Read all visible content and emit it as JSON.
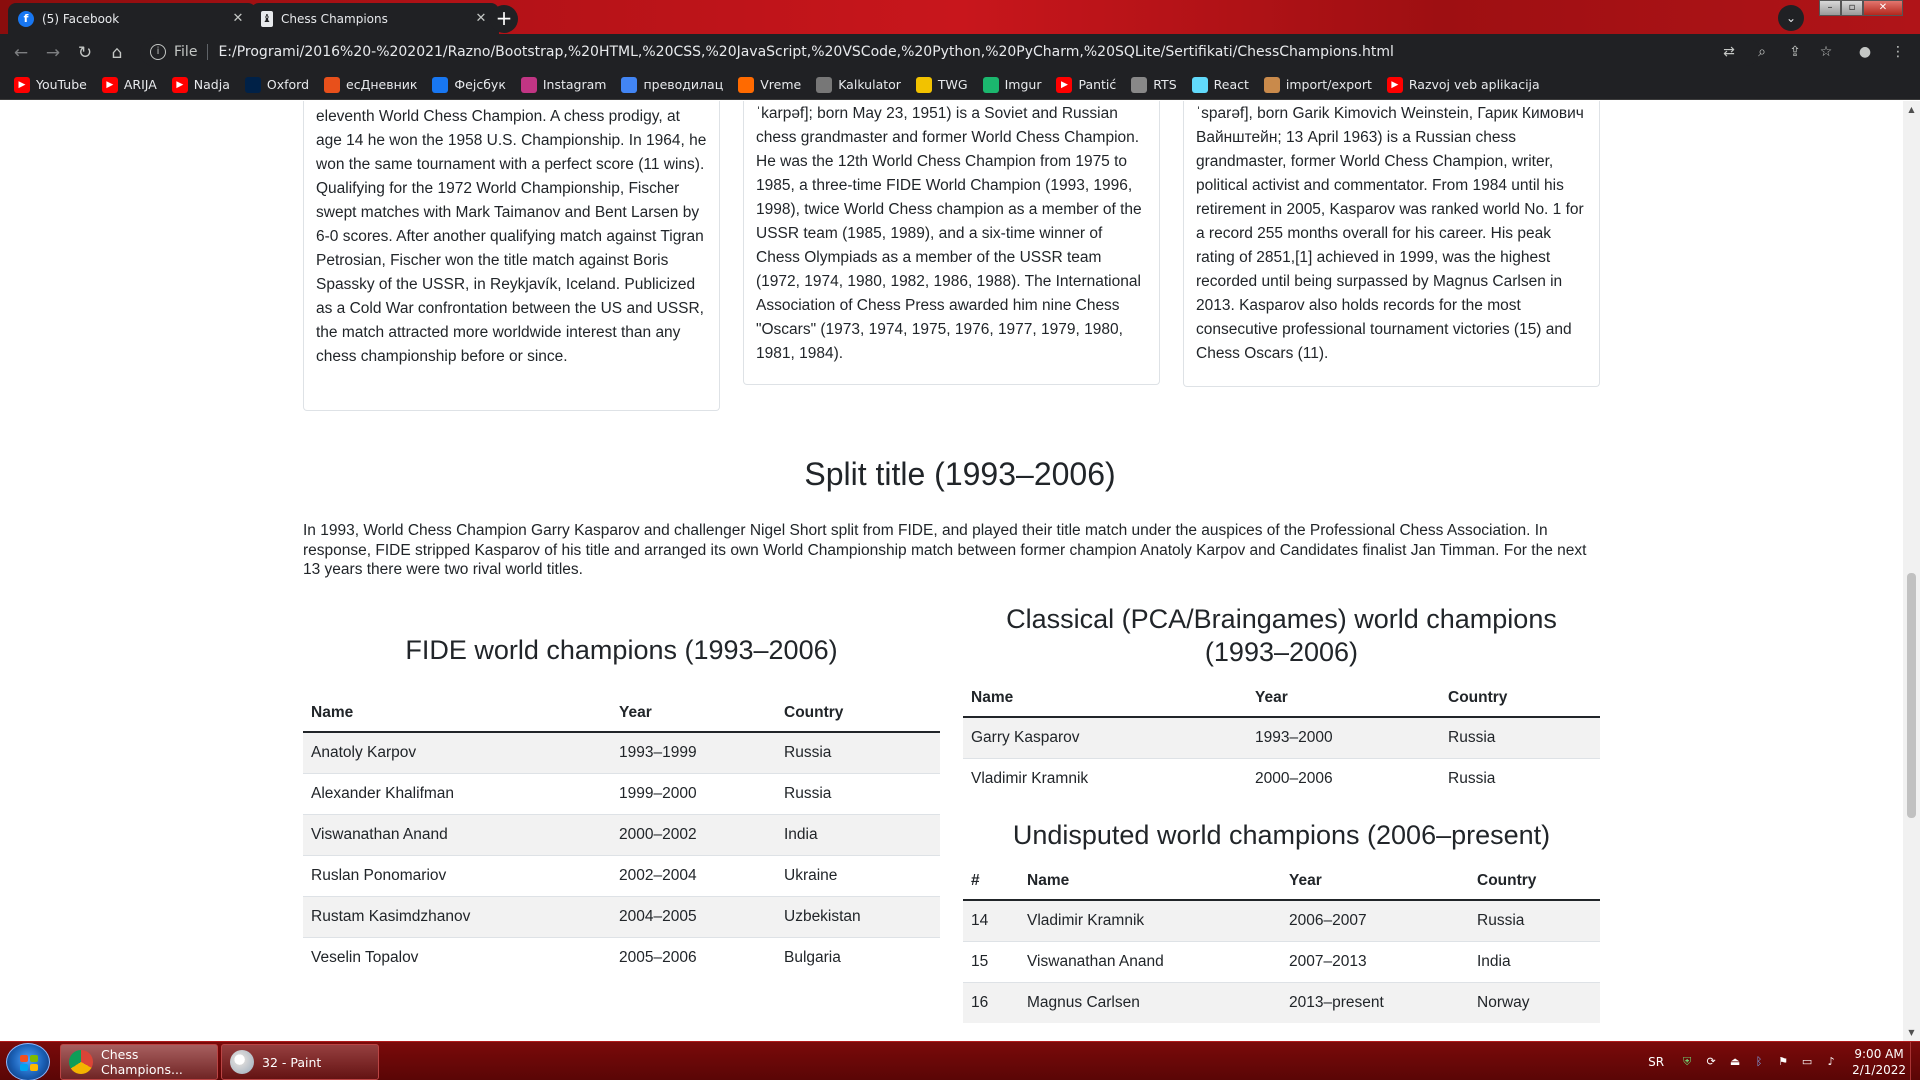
{
  "browser": {
    "tabs": [
      {
        "title": "(5) Facebook",
        "icon": "facebook-icon"
      },
      {
        "title": "Chess Champions",
        "icon": "chess-piece-icon"
      }
    ],
    "address": {
      "scheme": "File",
      "url": "E:/Programi/2016%20-%202021/Razno/Bootstrap,%20HTML,%20CSS,%20JavaScript,%20VSCode,%20Python,%20PyCharm,%20SQLite/Sertifikati/ChessChampions.html"
    },
    "bookmarks": [
      {
        "label": "YouTube",
        "icon": "youtube-icon",
        "color": "#ff0000"
      },
      {
        "label": "ARIJA",
        "icon": "youtube-icon",
        "color": "#ff0000"
      },
      {
        "label": "Nadja",
        "icon": "youtube-icon",
        "color": "#ff0000"
      },
      {
        "label": "Oxford",
        "icon": "oup-icon",
        "color": "#002147"
      },
      {
        "label": "есДневник",
        "icon": "esdnevnik-icon",
        "color": "#e8501b"
      },
      {
        "label": "Фејсбук",
        "icon": "facebook-icon",
        "color": "#1877f2"
      },
      {
        "label": "Instagram",
        "icon": "instagram-icon",
        "color": "#c13584"
      },
      {
        "label": "преводилац",
        "icon": "translate-icon",
        "color": "#4285f4"
      },
      {
        "label": "Vreme",
        "icon": "sun-icon",
        "color": "#ff6a00"
      },
      {
        "label": "Kalkulator",
        "icon": "calculator-icon",
        "color": "#777777"
      },
      {
        "label": "TWG",
        "icon": "twg-icon",
        "color": "#f2c200"
      },
      {
        "label": "Imgur",
        "icon": "imgur-icon",
        "color": "#1bb76e"
      },
      {
        "label": "Pantić",
        "icon": "youtube-icon",
        "color": "#ff0000"
      },
      {
        "label": "RTS",
        "icon": "rts-icon",
        "color": "#888888"
      },
      {
        "label": "React",
        "icon": "react-icon",
        "color": "#61dafb"
      },
      {
        "label": "import/export",
        "icon": "bookmarks-folder-icon",
        "color": "#c98a4b"
      },
      {
        "label": "Razvoj veb aplikacija",
        "icon": "youtube-icon",
        "color": "#ff0000"
      }
    ]
  },
  "page": {
    "cards": [
      "eleventh World Chess Champion. A chess prodigy, at age 14 he won the 1958 U.S. Championship. In 1964, he won the same tournament with a perfect score (11 wins). Qualifying for the 1972 World Championship, Fischer swept matches with Mark Taimanov and Bent Larsen by 6-0 scores. After another qualifying match against Tigran Petrosian, Fischer won the title match against Boris Spassky of the USSR, in Reykjavík, Iceland. Publicized as a Cold War confrontation between the US and USSR, the match attracted more worldwide interest than any chess championship before or since.",
      "ˈkarpəf]; born May 23, 1951) is a Soviet and Russian chess grandmaster and former World Chess Champion. He was the 12th World Chess Champion from 1975 to 1985, a three-time FIDE World Champion (1993, 1996, 1998), twice World Chess champion as a member of the USSR team (1985, 1989), and a six-time winner of Chess Olympiads as a member of the USSR team (1972, 1974, 1980, 1982, 1986, 1988). The International Association of Chess Press awarded him nine Chess \"Oscars\" (1973, 1974, 1975, 1976, 1977, 1979, 1980, 1981, 1984).",
      "ˈsparəf], born Garik Kimovich Weinstein, Гарик Кимович Вайнштейн; 13 April 1963) is a Russian chess grandmaster, former World Chess Champion, writer, political activist and commentator. From 1984 until his retirement in 2005, Kasparov was ranked world No. 1 for a record 255 months overall for his career. His peak rating of 2851,[1] achieved in 1999, was the highest recorded until being surpassed by Magnus Carlsen in 2013. Kasparov also holds records for the most consecutive professional tournament victories (15) and Chess Oscars (11)."
    ],
    "split_title": "Split title (1993–2006)",
    "split_intro": "In 1993, World Chess Champion Garry Kasparov and challenger Nigel Short split from FIDE, and played their title match under the auspices of the Professional Chess Association. In response, FIDE stripped Kasparov of his title and arranged its own World Championship match between former champion Anatoly Karpov and Candidates finalist Jan Timman. For the next 13 years there were two rival world titles.",
    "fide": {
      "heading": "FIDE world champions (1993–2006)",
      "headers": [
        "Name",
        "Year",
        "Country"
      ],
      "rows": [
        [
          "Anatoly Karpov",
          "1993–1999",
          "Russia"
        ],
        [
          "Alexander Khalifman",
          "1999–2000",
          "Russia"
        ],
        [
          "Viswanathan Anand",
          "2000–2002",
          "India"
        ],
        [
          "Ruslan Ponomariov",
          "2002–2004",
          "Ukraine"
        ],
        [
          "Rustam Kasimdzhanov",
          "2004–2005",
          "Uzbekistan"
        ],
        [
          "Veselin Topalov",
          "2005–2006",
          "Bulgaria"
        ]
      ]
    },
    "classical": {
      "heading": "Classical (PCA/Braingames) world champions (1993–2006)",
      "headers": [
        "Name",
        "Year",
        "Country"
      ],
      "rows": [
        [
          "Garry Kasparov",
          "1993–2000",
          "Russia"
        ],
        [
          "Vladimir Kramnik",
          "2000–2006",
          "Russia"
        ]
      ]
    },
    "undisputed": {
      "heading": "Undisputed world champions (2006–present)",
      "headers": [
        "#",
        "Name",
        "Year",
        "Country"
      ],
      "rows": [
        [
          "14",
          "Vladimir Kramnik",
          "2006–2007",
          "Russia"
        ],
        [
          "15",
          "Viswanathan Anand",
          "2007–2013",
          "India"
        ],
        [
          "16",
          "Magnus Carlsen",
          "2013–present",
          "Norway"
        ]
      ]
    }
  },
  "taskbar": {
    "items": [
      {
        "label": "Chess Champions...",
        "icon": "chrome-icon"
      },
      {
        "label": "32 - Paint",
        "icon": "paint-icon"
      }
    ],
    "language": "SR",
    "time": "9:00 AM",
    "date": "2/1/2022"
  }
}
